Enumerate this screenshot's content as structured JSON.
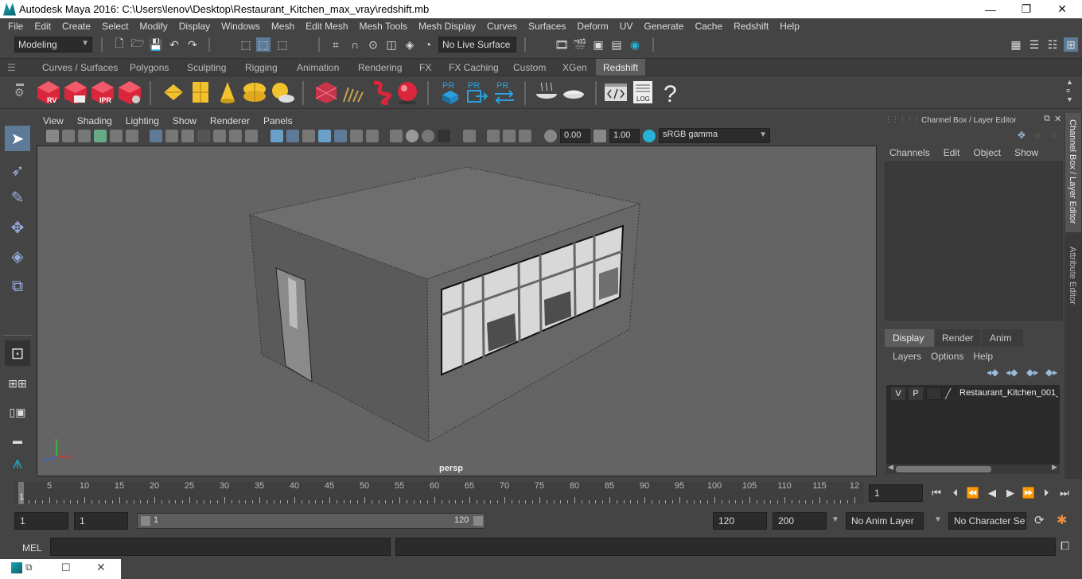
{
  "window": {
    "title": "Autodesk Maya 2016: C:\\Users\\lenov\\Desktop\\Restaurant_Kitchen_max_vray\\redshift.mb",
    "minimize": "—",
    "maximize": "❐",
    "close": "✕"
  },
  "menu": [
    "File",
    "Edit",
    "Create",
    "Select",
    "Modify",
    "Display",
    "Windows",
    "Mesh",
    "Edit Mesh",
    "Mesh Tools",
    "Mesh Display",
    "Curves",
    "Surfaces",
    "Deform",
    "UV",
    "Generate",
    "Cache",
    "Redshift",
    "Help"
  ],
  "status": {
    "mode": "Modeling",
    "live_surface": "No Live Surface"
  },
  "shelf_tabs": [
    "Curves / Surfaces",
    "Polygons",
    "Sculpting",
    "Rigging",
    "Animation",
    "Rendering",
    "FX",
    "FX Caching",
    "Custom",
    "XGen",
    "Redshift"
  ],
  "shelf_active": "Redshift",
  "shelf_labels": {
    "rv": "RV",
    "ipr": "IPR",
    "pr1": "PR",
    "pr2": "PR",
    "pr3": "PR",
    "log": "LOG",
    "help": "?"
  },
  "viewport": {
    "menu": [
      "View",
      "Shading",
      "Lighting",
      "Show",
      "Renderer",
      "Panels"
    ],
    "exposure": "0.00",
    "gamma": "1.00",
    "colorspace": "sRGB gamma",
    "camera_label": "persp",
    "axis_x": "x",
    "axis_y": "y",
    "axis_z": "z"
  },
  "channel_box": {
    "title": "Channel Box / Layer Editor",
    "menu": [
      "Channels",
      "Edit",
      "Object",
      "Show"
    ],
    "layer_tabs": [
      "Display",
      "Render",
      "Anim"
    ],
    "layer_menu": [
      "Layers",
      "Options",
      "Help"
    ],
    "layer": {
      "v": "V",
      "p": "P",
      "name": "Restaurant_Kitchen_001_"
    }
  },
  "side_tabs": {
    "channel_box": "Channel Box / Layer Editor",
    "attribute_editor": "Attribute Editor"
  },
  "timeline": {
    "ticks": [
      "5",
      "10",
      "15",
      "20",
      "25",
      "30",
      "35",
      "40",
      "45",
      "50",
      "55",
      "60",
      "65",
      "70",
      "75",
      "80",
      "85",
      "90",
      "95",
      "100",
      "105",
      "110",
      "115",
      "12"
    ],
    "start_marker": "1",
    "current_frame": "1"
  },
  "range": {
    "start": "1",
    "playback_start": "1",
    "slider_start": "1",
    "slider_end": "120",
    "playback_end": "120",
    "end": "200",
    "anim_layer": "No Anim Layer",
    "character_set": "No Character Set"
  },
  "cmd": {
    "lang": "MEL"
  },
  "colors": {
    "accent": "#5d5d5d",
    "viewport_bg": "#646464",
    "redshift_red": "#d9263b",
    "yellow": "#f2c12e",
    "blue": "#2b9fe0"
  }
}
